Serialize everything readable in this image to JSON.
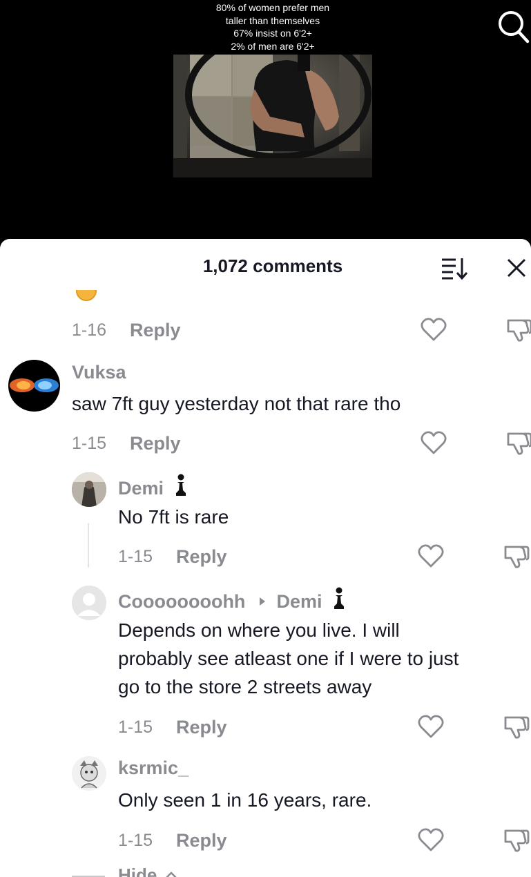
{
  "video": {
    "caption_lines": [
      "80% of women prefer men",
      "taller than themselves",
      "67% insist on 6'2+",
      "2% of men are 6'2+"
    ]
  },
  "sheet": {
    "title": "1,072 comments"
  },
  "comments": [
    {
      "date": "1-16",
      "reply_label": "Reply"
    },
    {
      "username": "Vuksa",
      "text": "saw 7ft guy yesterday not that rare tho",
      "date": "1-15",
      "reply_label": "Reply"
    },
    {
      "username": "Demi",
      "text": "No 7ft is rare",
      "date": "1-15",
      "reply_label": "Reply"
    },
    {
      "username": "Coooooooohh",
      "reply_to": "Demi",
      "text_lines": [
        "Depends on where you live. I will",
        "probably see atleast one if I were to just",
        "go to the store 2 streets away"
      ],
      "date": "1-15",
      "reply_label": "Reply"
    },
    {
      "username": "ksrmic_",
      "text": "Only seen 1 in 16 years, rare.",
      "date": "1-15",
      "reply_label": "Reply"
    }
  ],
  "hide_label": "Hide",
  "icons": [
    "search-icon",
    "sort-icon",
    "close-icon",
    "heart-icon",
    "dislike-icon",
    "chess-pawn-icon",
    "caret-right-icon",
    "chevron-up-icon"
  ]
}
